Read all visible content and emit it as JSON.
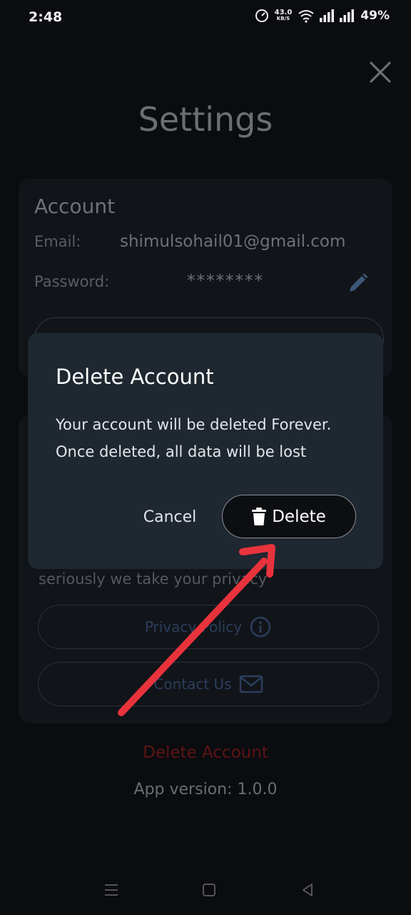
{
  "status_bar": {
    "time": "2:48",
    "net_speed_value": "43.0",
    "net_speed_unit": "KB/S",
    "battery": "49%"
  },
  "page": {
    "title": "Settings"
  },
  "account": {
    "heading": "Account",
    "email_label": "Email:",
    "email_value": "shimulsohail01@gmail.com",
    "password_label": "Password:",
    "password_value": "********"
  },
  "help": {
    "privacy_text": "seriously we take your privacy",
    "privacy_policy_label": "Privacy Policy",
    "contact_us_label": "Contact Us"
  },
  "footer": {
    "delete_account_label": "Delete Account",
    "app_version": "App version: 1.0.0"
  },
  "dialog": {
    "title": "Delete Account",
    "message_line1": "Your account will be deleted Forever.",
    "message_line2": "Once deleted, all data will be lost",
    "cancel_label": "Cancel",
    "delete_label": "Delete"
  },
  "colors": {
    "annotation_arrow": "#e8333c",
    "dialog_bg": "#1f2730",
    "danger_text": "#5e1414"
  }
}
